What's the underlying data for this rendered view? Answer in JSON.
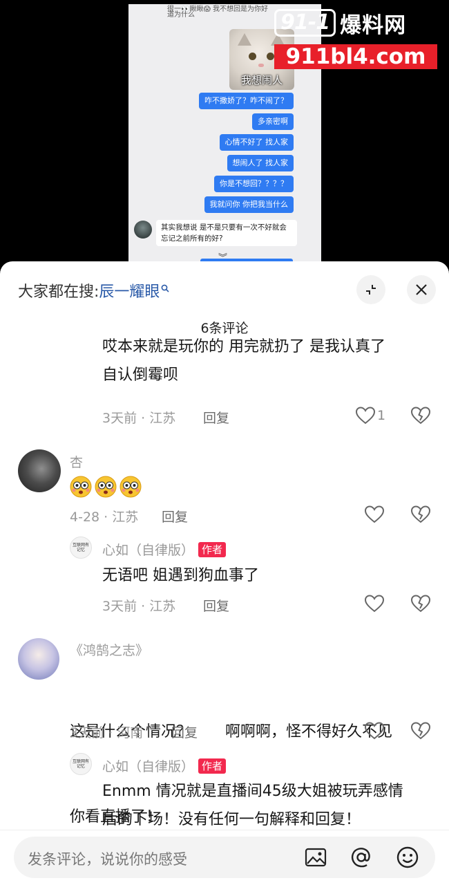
{
  "video": {
    "chat_top_note": "很一👀瞅瞅😱  我不想回是为你好",
    "chat_top_note2": "道为什么",
    "cat_caption": "我想闹人",
    "my_bubbles": [
      "咋不撒娇了？咋不闹了？",
      "多亲密啊",
      "心情不好了 找人家",
      "想闹人了 找人家",
      "你是不想回？？？？",
      "我就问你 你把我当什么"
    ],
    "other_bubble": "其实我想说 是不是只要有一次不好就会忘记之前所有的好?",
    "expand_glyph": "︾",
    "watermark": {
      "badge": "91-1",
      "title": "爆料网",
      "url": "911bl4.com"
    }
  },
  "sheet": {
    "search_prefix": "大家都在搜:",
    "search_term": "辰一耀眼",
    "comment_count": "6条评论",
    "comments": [
      {
        "text_line1": "哎本来就是玩你的 用完就扔了 是我认真了",
        "text_line2": "自认倒霉呗",
        "meta": "3天前 · 江苏",
        "reply": "回复",
        "likes": "1"
      },
      {
        "user": "杏",
        "emojis": [
          "😳",
          "😳",
          "😳"
        ],
        "meta": "4-28 · 江苏",
        "reply": "回复"
      },
      {
        "user": "心如（自律版）",
        "author_tag": "作者",
        "avatar_text": "互联网有记忆",
        "text_line1": "无语吧 姐遇到狗血事了",
        "meta": "3天前 · 江苏",
        "reply": "回复"
      },
      {
        "user": "《鸿鹄之志》",
        "text_line1": "这是什么个情况？       啊啊啊，怪不得好久不见",
        "text_line2": "你看直播了！",
        "meta": "3天前 · 河南",
        "reply": "回复"
      },
      {
        "user": "心如（自律版）",
        "author_tag": "作者",
        "avatar_text": "互联网有记忆",
        "text_line1": "Enmm 情况就是直播间45级大姐被玩弄感情",
        "text_line2": "后的下场！没有任何一句解释和回复！"
      }
    ],
    "input_placeholder": "发条评论，说说你的感受"
  }
}
